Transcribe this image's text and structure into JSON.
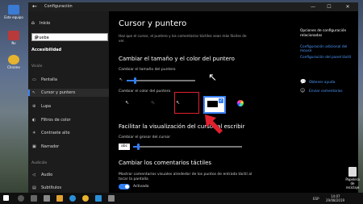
{
  "desktop": {
    "icons": [
      {
        "label": "Este equipo",
        "icon": "computer-icon",
        "color": "#3a7bd5"
      },
      {
        "label": "Nv",
        "icon": "app-icon",
        "color": "#b83a3a"
      },
      {
        "label": "Chrome",
        "icon": "chrome-icon",
        "color": "#e6b32e"
      }
    ],
    "recycle_bin": "Papelera de reciclaje"
  },
  "window": {
    "title": "Configuración",
    "back_icon": "←",
    "minimize": "—",
    "maximize": "☐",
    "close": "✕"
  },
  "nav": {
    "home": "Inicio",
    "home_icon": "⌂",
    "search_value": "prueba",
    "search_icon": "⚲",
    "section": "Accesibilidad",
    "group_vision": "Visión",
    "items_vision": [
      {
        "label": "Pantalla",
        "icon": "▭"
      },
      {
        "label": "Cursor y puntero",
        "icon": "↖"
      },
      {
        "label": "Lupa",
        "icon": "⊕"
      },
      {
        "label": "Filtros de color",
        "icon": "◐"
      },
      {
        "label": "Contraste alto",
        "icon": "☀"
      },
      {
        "label": "Narrador",
        "icon": "▣"
      }
    ],
    "group_audio": "Audición",
    "items_audio": [
      {
        "label": "Audio",
        "icon": "◁"
      },
      {
        "label": "Subtítulos",
        "icon": "▤"
      }
    ]
  },
  "main": {
    "title": "Cursor y puntero",
    "intro": "Haz que el cursor, el puntero y los comentarios táctiles sean más fáciles de ver.",
    "size_color_heading": "Cambiar el tamaño y el color del puntero",
    "pointer_size_label": "Cambiar el tamaño del puntero",
    "pointer_size": 0.12,
    "pointer_color_label": "Cambiar el color del puntero",
    "selected_color": 3,
    "cursor_heading": "Facilitar la visualización del cursor al escribir",
    "cursor_width_label": "Cambiar el grosor del cursor",
    "cursor_preview": "abc",
    "cursor_width": 0.05,
    "touch_heading": "Cambiar los comentarios táctiles",
    "touch_desc": "Mostrar comentarios visuales alrededor de los puntos de entrada táctil al tocar la pantalla",
    "touch_toggle": "Activado"
  },
  "related": {
    "heading": "Opciones de configuración relacionadas",
    "links": [
      "Configuración adicional del mouse",
      "Configuración del panel táctil"
    ],
    "help": "Obtener ayuda",
    "feedback": "Enviar comentarios"
  },
  "taskbar": {
    "lang": "ESP",
    "time": "14:07",
    "date": "29/08/2019"
  },
  "colors": {
    "accent": "#2f7ef5",
    "annotation": "#e0202e"
  }
}
